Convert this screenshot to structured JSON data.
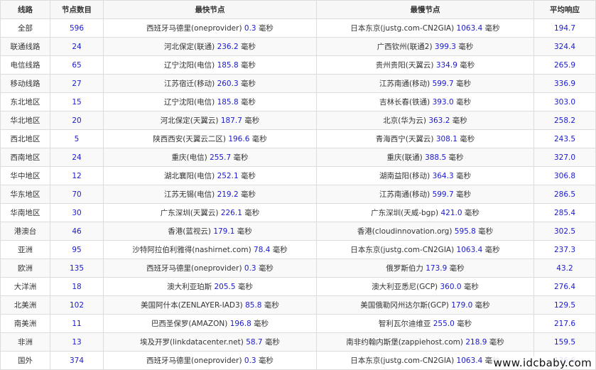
{
  "headers": [
    "线路",
    "节点数目",
    "最快节点",
    "最慢节点",
    "平均响应"
  ],
  "unit": "毫秒",
  "rows": [
    {
      "route": "全部",
      "count": "596",
      "fast_name": "西班牙马德里(oneprovider)",
      "fast_ms": "0.3",
      "slow_name": "日本东京(justg.com-CN2GIA)",
      "slow_ms": "1063.4",
      "avg": "194.7"
    },
    {
      "route": "联通线路",
      "count": "24",
      "fast_name": "河北保定(联通)",
      "fast_ms": "236.2",
      "slow_name": "广西钦州(联通2)",
      "slow_ms": "399.3",
      "avg": "324.4"
    },
    {
      "route": "电信线路",
      "count": "65",
      "fast_name": "辽宁沈阳(电信)",
      "fast_ms": "185.8",
      "slow_name": "贵州贵阳(天翼云)",
      "slow_ms": "334.9",
      "avg": "265.9"
    },
    {
      "route": "移动线路",
      "count": "27",
      "fast_name": "江苏宿迁(移动)",
      "fast_ms": "260.3",
      "slow_name": "江苏南通(移动)",
      "slow_ms": "599.7",
      "avg": "336.9"
    },
    {
      "route": "东北地区",
      "count": "15",
      "fast_name": "辽宁沈阳(电信)",
      "fast_ms": "185.8",
      "slow_name": "吉林长春(铁通)",
      "slow_ms": "393.0",
      "avg": "303.0"
    },
    {
      "route": "华北地区",
      "count": "20",
      "fast_name": "河北保定(天翼云)",
      "fast_ms": "187.7",
      "slow_name": "北京(华为云)",
      "slow_ms": "363.2",
      "avg": "258.2"
    },
    {
      "route": "西北地区",
      "count": "5",
      "fast_name": "陕西西安(天翼云二区)",
      "fast_ms": "196.6",
      "slow_name": "青海西宁(天翼云)",
      "slow_ms": "308.1",
      "avg": "243.5"
    },
    {
      "route": "西南地区",
      "count": "24",
      "fast_name": "重庆(电信)",
      "fast_ms": "255.7",
      "slow_name": "重庆(联通)",
      "slow_ms": "388.5",
      "avg": "327.0"
    },
    {
      "route": "华中地区",
      "count": "12",
      "fast_name": "湖北襄阳(电信)",
      "fast_ms": "252.1",
      "slow_name": "湖南益阳(移动)",
      "slow_ms": "364.3",
      "avg": "306.8"
    },
    {
      "route": "华东地区",
      "count": "70",
      "fast_name": "江苏无锡(电信)",
      "fast_ms": "219.2",
      "slow_name": "江苏南通(移动)",
      "slow_ms": "599.7",
      "avg": "286.5"
    },
    {
      "route": "华南地区",
      "count": "30",
      "fast_name": "广东深圳(天翼云)",
      "fast_ms": "226.1",
      "slow_name": "广东深圳(天威-bgp)",
      "slow_ms": "421.0",
      "avg": "285.4"
    },
    {
      "route": "港澳台",
      "count": "46",
      "fast_name": "香港(蓝视云)",
      "fast_ms": "179.1",
      "slow_name": "香港(cloudinnovation.org)",
      "slow_ms": "595.8",
      "avg": "302.5"
    },
    {
      "route": "亚洲",
      "count": "95",
      "fast_name": "沙特阿拉伯利雅得(nashirnet.com)",
      "fast_ms": "78.4",
      "slow_name": "日本东京(justg.com-CN2GIA)",
      "slow_ms": "1063.4",
      "avg": "237.3"
    },
    {
      "route": "欧洲",
      "count": "135",
      "fast_name": "西班牙马德里(oneprovider)",
      "fast_ms": "0.3",
      "slow_name": "俄罗斯伯力",
      "slow_ms": "173.9",
      "avg": "43.2"
    },
    {
      "route": "大洋洲",
      "count": "18",
      "fast_name": "澳大利亚珀斯",
      "fast_ms": "205.5",
      "slow_name": "澳大利亚悉尼(GCP)",
      "slow_ms": "360.0",
      "avg": "276.4"
    },
    {
      "route": "北美洲",
      "count": "102",
      "fast_name": "美国阿什本(ZENLAYER-IAD3)",
      "fast_ms": "85.8",
      "slow_name": "美国俄勒冈州达尔斯(GCP)",
      "slow_ms": "179.0",
      "avg": "129.5"
    },
    {
      "route": "南美洲",
      "count": "11",
      "fast_name": "巴西圣保罗(AMAZON)",
      "fast_ms": "196.8",
      "slow_name": "智利瓦尔迪维亚",
      "slow_ms": "255.0",
      "avg": "217.6"
    },
    {
      "route": "非洲",
      "count": "13",
      "fast_name": "埃及开罗(linkdatacenter.net)",
      "fast_ms": "58.7",
      "slow_name": "南非约翰内斯堡(zappiehost.com)",
      "slow_ms": "218.9",
      "avg": "159.5"
    },
    {
      "route": "国外",
      "count": "374",
      "fast_name": "西班牙马德里(oneprovider)",
      "fast_ms": "0.3",
      "slow_name": "日本东京(justg.com-CN2GIA)",
      "slow_ms": "1063.4",
      "avg": "136.6"
    }
  ],
  "watermark": "www.idcbaby.com",
  "colors": {
    "number": "#1a1acc",
    "border": "#dcdcdc",
    "header_bg": "#f7f7f7"
  }
}
